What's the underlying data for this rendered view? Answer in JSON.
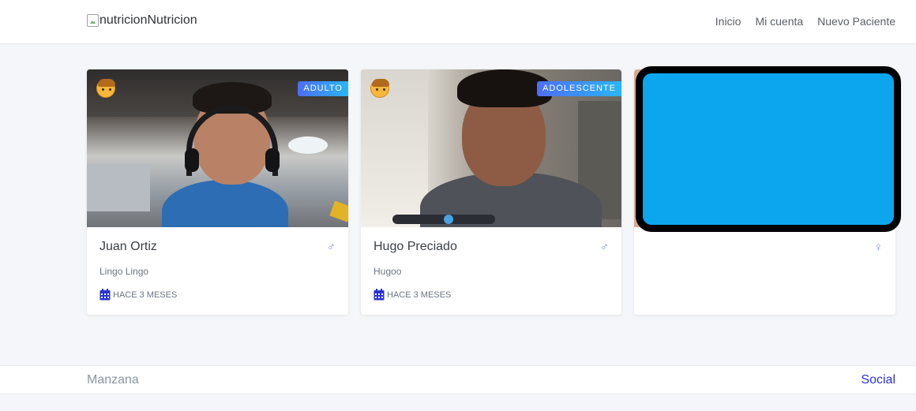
{
  "navbar": {
    "brand_text": "Nutricion",
    "brand_alt": "nutricion",
    "links": [
      "Inicio",
      "Mi cuenta",
      "Nuevo Paciente"
    ]
  },
  "patients": [
    {
      "name": "Juan Ortiz",
      "username": "Lingo Lingo",
      "category": "ADULTO",
      "time": "HACE 3 MESES",
      "gender_icon": "♂"
    },
    {
      "name": "Hugo Preciado",
      "username": "Hugoo",
      "category": "ADOLESCENTE",
      "time": "HACE 3 MESES",
      "gender_icon": "♂"
    },
    {
      "name": "",
      "username": "",
      "category": "",
      "time": "",
      "gender_icon": "♀"
    }
  ],
  "footer": {
    "left": "Manzana",
    "right": "Social"
  },
  "colors": {
    "accent": "#2a33d6",
    "badge_start": "#4c6ef5",
    "badge_end": "#29b6f6",
    "overlay_blue": "#0ba6ee"
  }
}
